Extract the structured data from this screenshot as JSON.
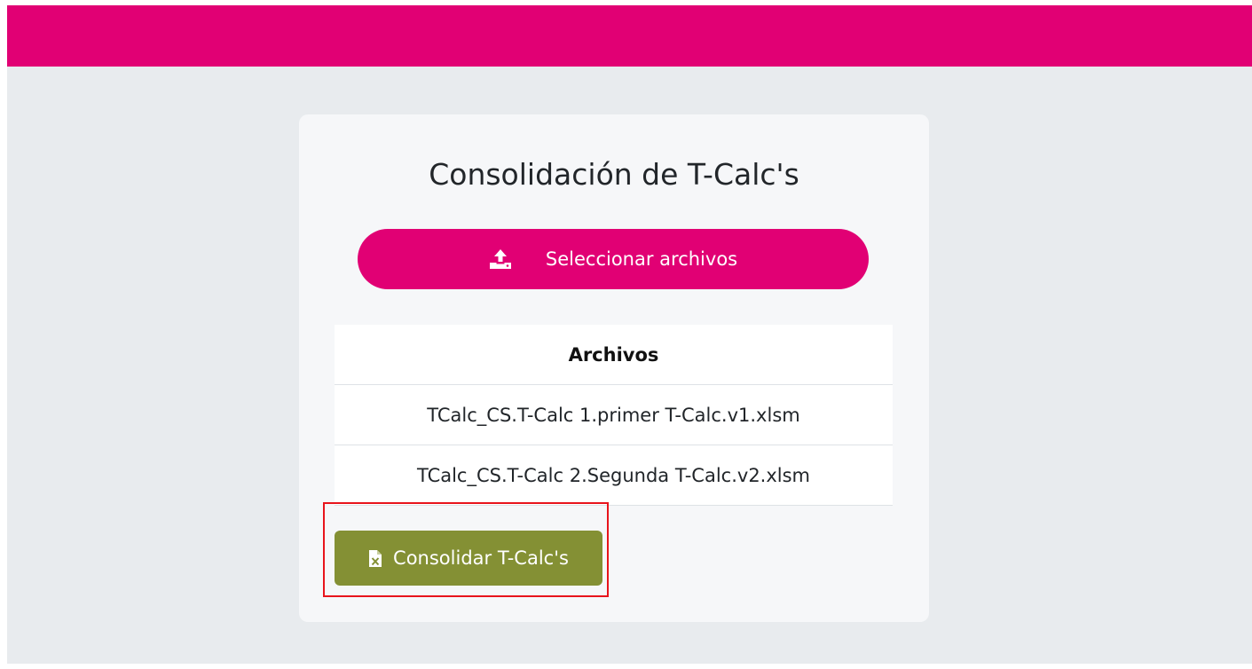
{
  "header": {
    "brand_color": "#e10074"
  },
  "card": {
    "title": "Consolidación de T-Calc's",
    "select_button": {
      "label": "Seleccionar archivos",
      "icon": "upload-icon"
    },
    "files_table": {
      "header": "Archivos",
      "rows": [
        "TCalc_CS.T-Calc 1.primer T-Calc.v1.xlsm",
        "TCalc_CS.T-Calc 2.Segunda T-Calc.v2.xlsm"
      ]
    },
    "consolidate_button": {
      "label": "Consolidar T-Calc's",
      "icon": "excel-file-icon",
      "color": "#849034",
      "highlight_color": "#e8141c"
    }
  }
}
